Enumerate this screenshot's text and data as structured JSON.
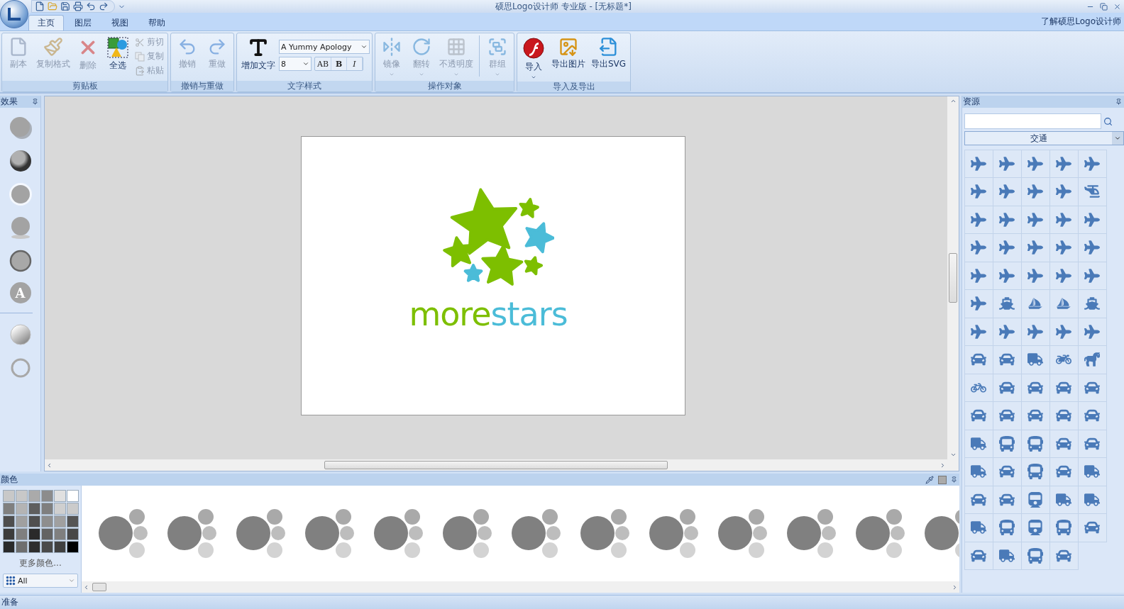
{
  "title_bar": {
    "title": "硕思Logo设计师 专业版 - [无标题*]"
  },
  "menu_tabs": [
    {
      "label": "主页",
      "selected": true
    },
    {
      "label": "图层",
      "selected": false
    },
    {
      "label": "视图",
      "selected": false
    },
    {
      "label": "帮助",
      "selected": false
    }
  ],
  "help_link": "了解硕思Logo设计师",
  "ribbon_groups": [
    {
      "label": "剪贴板",
      "buttons": [
        {
          "kind": "large",
          "label": "副本",
          "disabled": true
        },
        {
          "kind": "large",
          "label": "复制格式",
          "disabled": true
        },
        {
          "kind": "large",
          "label": "删除",
          "disabled": true
        },
        {
          "kind": "large",
          "label": "全选",
          "disabled": false
        },
        {
          "kind": "small",
          "label": "剪切",
          "disabled": true
        },
        {
          "kind": "small",
          "label": "复制",
          "disabled": true
        },
        {
          "kind": "small",
          "label": "粘贴",
          "disabled": true
        }
      ]
    },
    {
      "label": "撤销与重做",
      "buttons": [
        {
          "kind": "large",
          "label": "撤销",
          "disabled": true
        },
        {
          "kind": "large",
          "label": "重做",
          "disabled": true
        }
      ]
    },
    {
      "label": "文字样式",
      "buttons": [
        {
          "kind": "large",
          "label": "增加文字",
          "disabled": false
        }
      ],
      "font": {
        "value": "A Yummy Apology"
      },
      "size": {
        "value": "8"
      },
      "format_buttons": [
        {
          "kind": "spacing",
          "label": "AB"
        },
        {
          "kind": "bold",
          "label": "B"
        },
        {
          "kind": "italic",
          "label": "I"
        }
      ]
    },
    {
      "label": "操作对象",
      "buttons": [
        {
          "kind": "large",
          "label": "镜像",
          "disabled": true,
          "has_menu": true
        },
        {
          "kind": "large",
          "label": "翻转",
          "disabled": true,
          "has_menu": true
        },
        {
          "kind": "large",
          "label": "不透明度",
          "disabled": true,
          "has_menu": true
        },
        {
          "kind": "separator"
        },
        {
          "kind": "large",
          "label": "群组",
          "disabled": true,
          "has_menu": true
        }
      ]
    },
    {
      "label": "导入及导出",
      "buttons": [
        {
          "kind": "large",
          "label": "导入",
          "disabled": false,
          "has_menu": true
        },
        {
          "kind": "large",
          "label": "导出图片",
          "disabled": false
        },
        {
          "kind": "large",
          "label": "导出SVG",
          "disabled": false
        }
      ]
    }
  ],
  "effects_panel": {
    "title": "效果",
    "effects": [
      {
        "kind": "shadow"
      },
      {
        "kind": "bevel"
      },
      {
        "kind": "glow"
      },
      {
        "kind": "reflection"
      },
      {
        "kind": "outline"
      },
      {
        "kind": "text",
        "label": "A"
      },
      {
        "kind": "separator"
      },
      {
        "kind": "gradient"
      },
      {
        "kind": "ring"
      }
    ]
  },
  "logo": {
    "wordmark": [
      {
        "text": "more",
        "color": "#7dbf00"
      },
      {
        "text": "stars",
        "color": "#4bbcd8"
      }
    ]
  },
  "colors_panel": {
    "title": "颜色",
    "swatches": [
      {
        "color": "#c8c8c8"
      },
      {
        "color": "#c8c8c8"
      },
      {
        "color": "#aaaaaa"
      },
      {
        "color": "#8c8c8c"
      },
      {
        "color": "#e0e0e0"
      },
      {
        "color": "#ffffff"
      },
      {
        "color": "#808080"
      },
      {
        "color": "#b4b4b4"
      },
      {
        "color": "#5e5e5e"
      },
      {
        "color": "#7f7f7f"
      },
      {
        "color": "#cfcfcf"
      },
      {
        "color": "#cbcbcb"
      },
      {
        "color": "#4e4e4e"
      },
      {
        "color": "#a0a0a0"
      },
      {
        "color": "#4f4f4f"
      },
      {
        "color": "#8e8e8e"
      },
      {
        "color": "#a0a0a0"
      },
      {
        "color": "#555555"
      },
      {
        "color": "#3c3c3c"
      },
      {
        "color": "#7f7f7f"
      },
      {
        "color": "#2a2a2a"
      },
      {
        "color": "#636363"
      },
      {
        "color": "#7f7f7f"
      },
      {
        "color": "#484848"
      },
      {
        "color": "#2a2a2a"
      },
      {
        "color": "#6e6e6e"
      },
      {
        "color": "#2e2e2e"
      },
      {
        "color": "#4a4a4a"
      },
      {
        "color": "#404040"
      },
      {
        "color": "#000000"
      }
    ],
    "more_colors": "更多颜色...",
    "filter": {
      "value": "All"
    }
  },
  "resources_panel": {
    "title": "资源",
    "category": {
      "value": "交通"
    },
    "items": [
      {
        "kind": "plane"
      },
      {
        "kind": "plane"
      },
      {
        "kind": "plane"
      },
      {
        "kind": "plane"
      },
      {
        "kind": "plane"
      },
      {
        "kind": "plane"
      },
      {
        "kind": "plane"
      },
      {
        "kind": "plane"
      },
      {
        "kind": "plane"
      },
      {
        "kind": "helicopter"
      },
      {
        "kind": "plane"
      },
      {
        "kind": "plane"
      },
      {
        "kind": "plane"
      },
      {
        "kind": "plane"
      },
      {
        "kind": "plane"
      },
      {
        "kind": "plane"
      },
      {
        "kind": "plane"
      },
      {
        "kind": "plane"
      },
      {
        "kind": "plane"
      },
      {
        "kind": "plane"
      },
      {
        "kind": "plane"
      },
      {
        "kind": "plane"
      },
      {
        "kind": "plane"
      },
      {
        "kind": "plane"
      },
      {
        "kind": "plane"
      },
      {
        "kind": "plane"
      },
      {
        "kind": "ship"
      },
      {
        "kind": "sailboat"
      },
      {
        "kind": "sailboat"
      },
      {
        "kind": "ship"
      },
      {
        "kind": "plane"
      },
      {
        "kind": "plane"
      },
      {
        "kind": "plane"
      },
      {
        "kind": "plane"
      },
      {
        "kind": "plane"
      },
      {
        "kind": "car"
      },
      {
        "kind": "car"
      },
      {
        "kind": "truck"
      },
      {
        "kind": "motorcycle"
      },
      {
        "kind": "horse"
      },
      {
        "kind": "bicycle"
      },
      {
        "kind": "car"
      },
      {
        "kind": "car"
      },
      {
        "kind": "car"
      },
      {
        "kind": "car"
      },
      {
        "kind": "car"
      },
      {
        "kind": "car"
      },
      {
        "kind": "car"
      },
      {
        "kind": "car"
      },
      {
        "kind": "car"
      },
      {
        "kind": "truck"
      },
      {
        "kind": "bus"
      },
      {
        "kind": "bus"
      },
      {
        "kind": "car"
      },
      {
        "kind": "car"
      },
      {
        "kind": "truck"
      },
      {
        "kind": "car"
      },
      {
        "kind": "bus"
      },
      {
        "kind": "car"
      },
      {
        "kind": "truck"
      },
      {
        "kind": "car"
      },
      {
        "kind": "car"
      },
      {
        "kind": "train"
      },
      {
        "kind": "truck"
      },
      {
        "kind": "truck"
      },
      {
        "kind": "truck"
      },
      {
        "kind": "bus"
      },
      {
        "kind": "train"
      },
      {
        "kind": "bus"
      },
      {
        "kind": "car"
      },
      {
        "kind": "car"
      },
      {
        "kind": "truck"
      },
      {
        "kind": "bus"
      },
      {
        "kind": "car"
      }
    ]
  },
  "status_bar": {
    "text": "准备"
  }
}
